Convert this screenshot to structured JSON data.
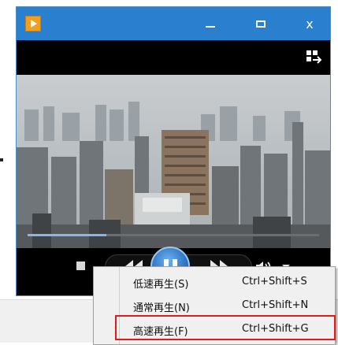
{
  "window": {
    "app_icon": "play-icon",
    "title_buttons": [
      "minimize-icon",
      "maximize-icon",
      "close-icon"
    ],
    "close_label": "x",
    "accent_color": "#2b7fcf"
  },
  "player": {
    "fullscreen_icon": "fullscreen-toggle-icon",
    "seek_progress": 0.27,
    "controls": [
      "stop-icon",
      "rewind-icon",
      "pause-icon",
      "fast-forward-icon",
      "volume-icon",
      "chevron-down-icon"
    ]
  },
  "context_menu": {
    "items": [
      {
        "label": "低速再生(S)",
        "shortcut": "Ctrl+Shift+S"
      },
      {
        "label": "通常再生(N)",
        "shortcut": "Ctrl+Shift+N"
      },
      {
        "label": "高速再生(F)",
        "shortcut": "Ctrl+Shift+G"
      }
    ],
    "highlight_color": "#e81818"
  }
}
